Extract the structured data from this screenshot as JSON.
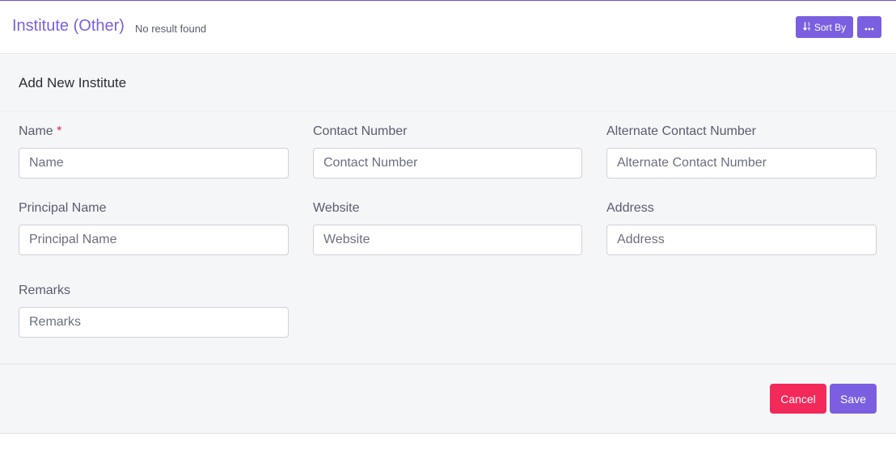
{
  "header": {
    "title": "Institute (Other)",
    "subtitle": "No result found",
    "sort_label": "Sort By",
    "sort_icon": "sort-numeric-icon",
    "more_icon": "ellipsis-icon"
  },
  "form": {
    "title": "Add New Institute",
    "required_mark": "*",
    "fields": [
      {
        "label": "Name",
        "placeholder": "Name"
      },
      {
        "label": "Contact Number",
        "placeholder": "Contact Number"
      },
      {
        "label": "Alternate Contact Number",
        "placeholder": "Alternate Contact Number"
      },
      {
        "label": "Principal Name",
        "placeholder": "Principal Name"
      },
      {
        "label": "Website",
        "placeholder": "Website"
      },
      {
        "label": "Address",
        "placeholder": "Address"
      },
      {
        "label": "Remarks",
        "placeholder": "Remarks"
      }
    ],
    "cancel_label": "Cancel",
    "save_label": "Save"
  },
  "colors": {
    "brand": "#7b5fe0",
    "danger": "#f3295a"
  }
}
